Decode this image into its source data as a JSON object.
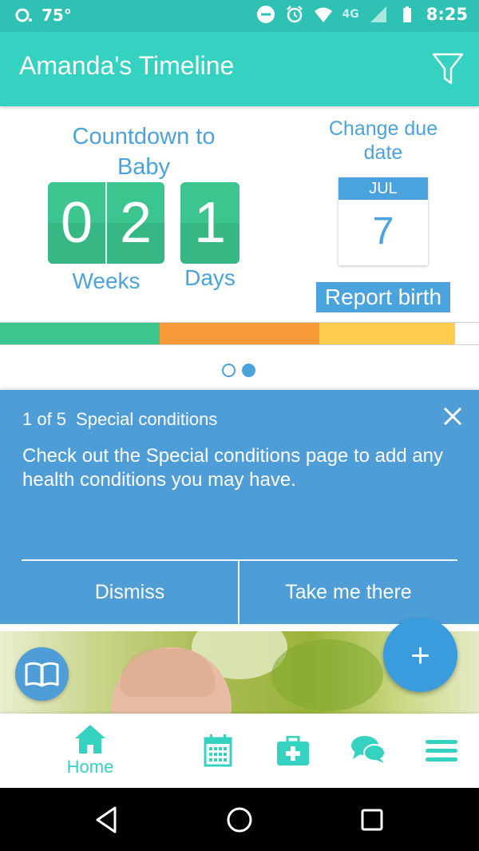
{
  "status_bar": {
    "temperature": "75°",
    "network": "4G",
    "time": "8:25"
  },
  "app_bar": {
    "title": "Amanda's Timeline",
    "filter_icon": "filter-icon"
  },
  "countdown": {
    "title": "Countdown to Baby",
    "weeks_digits": [
      "0",
      "2"
    ],
    "weeks_label": "Weeks",
    "days_digit": "1",
    "days_label": "Days"
  },
  "due_date": {
    "title": "Change due date",
    "month": "JUL",
    "day": "7",
    "report_label": "Report birth"
  },
  "progress_colors": [
    "#3cc58f",
    "#f79a38",
    "#ffcc4d"
  ],
  "pager": {
    "total": 2,
    "active": 2
  },
  "tip": {
    "counter": "1 of 5",
    "title": "Special conditions",
    "text": "Check out the Special conditions page to add any health conditions you may have.",
    "dismiss_label": "Dismiss",
    "go_label": "Take me there"
  },
  "fab_label": "+",
  "bottom_nav": {
    "home_label": "Home",
    "items": [
      "home-icon",
      "calendar-icon",
      "medical-kit-icon",
      "chat-icon",
      "menu-icon"
    ]
  },
  "colors": {
    "accent": "#35d1c1",
    "blue": "#4aa3dc",
    "card": "#4e9dd7"
  }
}
